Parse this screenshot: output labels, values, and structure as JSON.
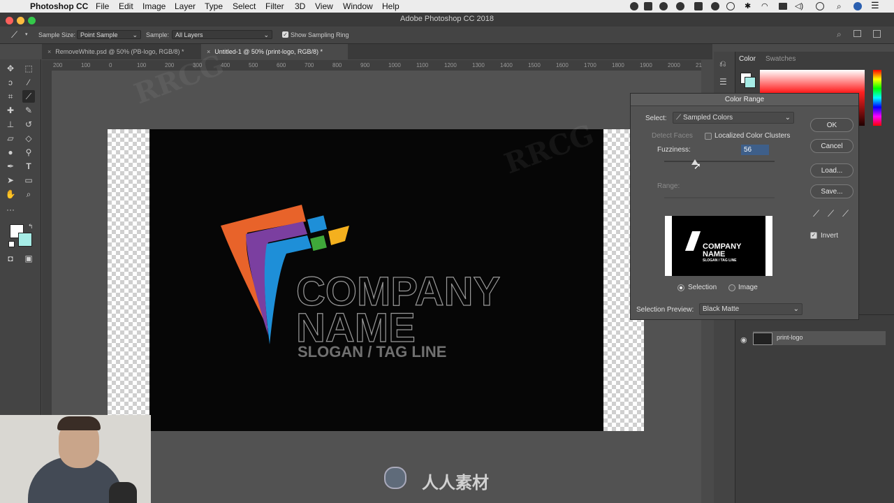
{
  "menubar": {
    "apple": "",
    "app_name": "Photoshop CC",
    "items": [
      "File",
      "Edit",
      "Image",
      "Layer",
      "Type",
      "Select",
      "Filter",
      "3D",
      "View",
      "Window",
      "Help"
    ]
  },
  "window": {
    "title": "Adobe Photoshop CC 2018"
  },
  "options_bar": {
    "sample_size_label": "Sample Size:",
    "sample_size_value": "Point Sample",
    "sample_label": "Sample:",
    "sample_value": "All Layers",
    "show_sampling_ring": "Show Sampling Ring"
  },
  "tabs": [
    {
      "label": "RemoveWhite.psd @ 50% (PB-logo, RGB/8) *",
      "active": false
    },
    {
      "label": "Untitled-1 @ 50% (print-logo, RGB/8) *",
      "active": true
    }
  ],
  "ruler_labels": [
    "200",
    "100",
    "0",
    "100",
    "200",
    "300",
    "400",
    "500",
    "600",
    "700",
    "800",
    "900",
    "1000",
    "1100",
    "1200",
    "1300",
    "1400",
    "1500",
    "1600",
    "1700",
    "1800",
    "1900",
    "2000",
    "21"
  ],
  "canvas": {
    "logo_line1": "COMPANY",
    "logo_line2": "NAME",
    "slogan": "SLOGAN / TAG LINE"
  },
  "panels": {
    "color_tab": "Color",
    "swatches_tab": "Swatches",
    "layer_name": "print-logo"
  },
  "dialog": {
    "title": "Color Range",
    "select_label": "Select:",
    "select_value": "Sampled Colors",
    "detect_faces": "Detect Faces",
    "localized_clusters": "Localized Color Clusters",
    "fuzziness_label": "Fuzziness:",
    "fuzziness_value": "56",
    "fuzziness_level": 0.28,
    "range_label": "Range:",
    "buttons": {
      "ok": "OK",
      "cancel": "Cancel",
      "load": "Load...",
      "save": "Save..."
    },
    "invert_label": "Invert",
    "invert_checked": true,
    "preview": {
      "line1": "COMPANY",
      "line2": "NAME",
      "line3": "SLOGAN / TAG LINE"
    },
    "radio_selection": "Selection",
    "radio_image": "Image",
    "selection_preview_label": "Selection Preview:",
    "selection_preview_value": "Black Matte"
  },
  "watermark": {
    "text_cn": "人人素材",
    "text_en": "RRCG"
  },
  "colors": {
    "dialog_bg": "#535353",
    "toolbar_bg": "#444444",
    "artboard_bg": "#060606",
    "logo_orange": "#e8632a",
    "logo_purple": "#7b3fa0",
    "logo_blue": "#1e8fd8",
    "logo_green": "#3fa83a",
    "logo_yellow": "#f4b01e",
    "foreground_swatch": "#ffffff",
    "background_swatch": "#a6ece6"
  }
}
